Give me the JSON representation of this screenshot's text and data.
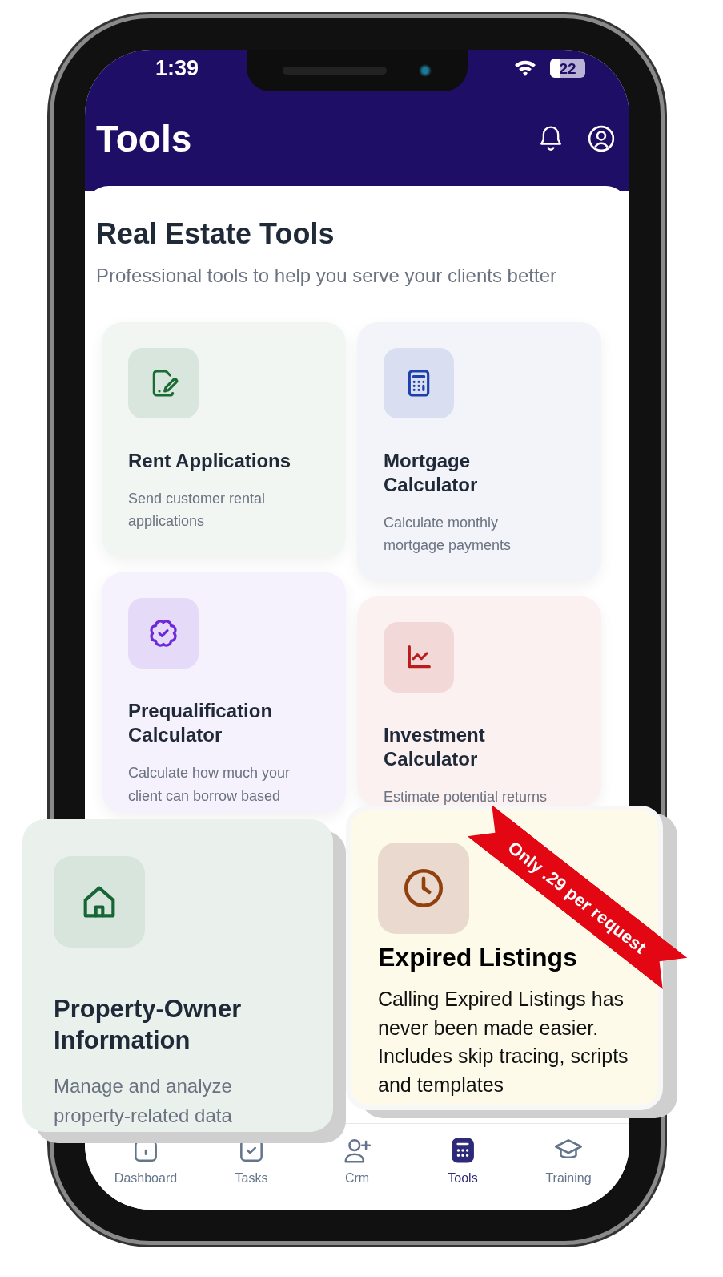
{
  "status_bar": {
    "time": "1:39",
    "battery": "22"
  },
  "header": {
    "title": "Tools"
  },
  "section": {
    "title": "Real Estate Tools",
    "subtitle": "Professional tools to help you serve your clients better"
  },
  "tools": [
    {
      "title": "Rent Applications",
      "description": "Send customer rental applications",
      "color": "#1a6b35"
    },
    {
      "title": "Mortgage Calculator",
      "description": "Calculate monthly mortgage payments",
      "color": "#1e40af"
    },
    {
      "title": "Prequalification Calculator",
      "description": "Calculate how much your client can borrow based",
      "color": "#6d28d9"
    },
    {
      "title": "Investment Calculator",
      "description": "Estimate potential returns",
      "color": "#b91c1c"
    }
  ],
  "featured": [
    {
      "title": "Property-Owner Information",
      "description": "Manage and analyze property-related data",
      "color": "#166534"
    },
    {
      "title": "Expired Listings",
      "description": "Calling Expired Listings has never been made easier. Includes skip tracing, scripts and templates",
      "color": "#92400e",
      "ribbon": "Only .29 per request"
    }
  ],
  "nav": [
    {
      "label": "Dashboard",
      "selected": false
    },
    {
      "label": "Tasks",
      "selected": false
    },
    {
      "label": "Crm",
      "selected": false
    },
    {
      "label": "Tools",
      "selected": true
    },
    {
      "label": "Training",
      "selected": false
    }
  ]
}
